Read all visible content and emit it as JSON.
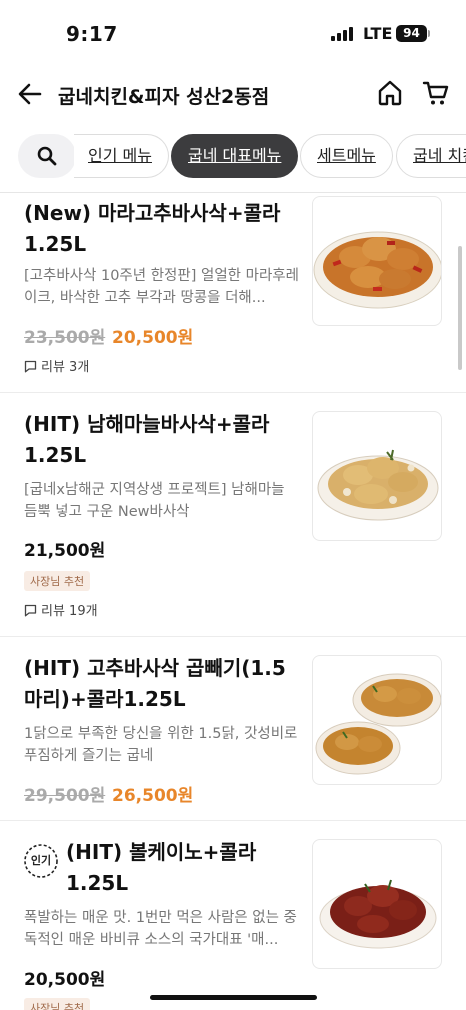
{
  "status_bar": {
    "time": "9:17",
    "network": "LTE",
    "battery": "94"
  },
  "header": {
    "title": "굽네치킨&피자 성산2동점"
  },
  "tabs": [
    {
      "label": "인기 메뉴"
    },
    {
      "label": "굽네 대표메뉴"
    },
    {
      "label": "세트메뉴"
    },
    {
      "label": "굽네 치킨"
    }
  ],
  "items": [
    {
      "name": "(New) 마라고추바사삭+콜라 1.25L",
      "desc": "[고추바사삭 10주년 한정판] 얼얼한 마라후레이크, 바삭한 고추 부각과 땅콩을 더해...",
      "price_old": "23,500원",
      "price": "20,500원",
      "review": "리뷰 3개"
    },
    {
      "name": "(HIT) 남해마늘바사삭+콜라 1.25L",
      "desc": "[굽네x남해군 지역상생 프로젝트] 남해마늘 듬뿍 넣고 구운 New바사삭",
      "price": "21,500원",
      "badge": "사장님 추천",
      "review": "리뷰 19개"
    },
    {
      "name": "(HIT) 고추바사삭 곱빼기(1.5마리)+콜라1.25L",
      "desc": "1닭으로 부족한 당신을 위한 1.5닭, 갓성비로 푸짐하게 즐기는 굽네",
      "price_old": "29,500원",
      "price": "26,500원"
    },
    {
      "popular_label": "인기",
      "name": "(HIT) 볼케이노+콜라 1.25L",
      "desc": "폭발하는 매운 맛. 1번만 먹은 사람은 없는 중독적인 매운 바비큐 소스의 국가대표 '매...",
      "price": "20,500원",
      "badge": "사장님 추천"
    }
  ],
  "colors": {
    "accent": "#e8862a",
    "active_tab": "#3c3c3e"
  }
}
